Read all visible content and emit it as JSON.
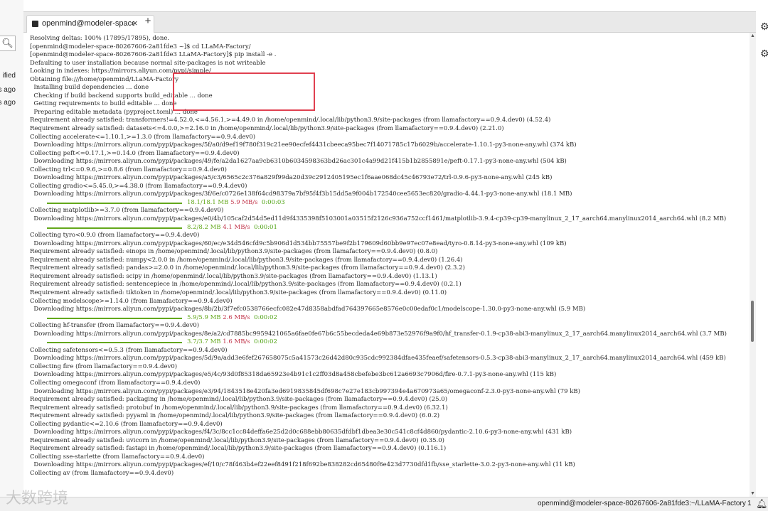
{
  "left_panel": {
    "search_icon": "search-icon",
    "labels": [
      "ified",
      "s ago",
      "s ago"
    ]
  },
  "right_panel": {
    "icons": [
      "gear-icon",
      "settings-icon"
    ]
  },
  "terminal": {
    "tab_title": "openmind@modeler-space-8",
    "tab_close": "×",
    "new_tab": "+",
    "lines": [
      {
        "text": "Resolving deltas: 100% (17895/17895), done."
      },
      {
        "text": "[openmind@modeler-space-80267606-2a81fde3 ~]$ cd LLaMA-Factory/"
      },
      {
        "text": "[openmind@modeler-space-80267606-2a81fde3 LLaMA-Factory]$ pip install -e ."
      },
      {
        "text": "Defaulting to user installation because normal site-packages is not writeable"
      },
      {
        "text": "Looking in indexes: https://mirrors.aliyun.com/pypi/simple/"
      },
      {
        "text": "Obtaining file:///home/openmind/LLaMA-Factory"
      },
      {
        "text": "  Installing build dependencies ... done"
      },
      {
        "text": "  Checking if build backend supports build_editable ... done"
      },
      {
        "text": "  Getting requirements to build editable ... done"
      },
      {
        "text": "  Preparing editable metadata (pyproject.toml) ... done"
      },
      {
        "text": "Requirement already satisfied: transformers!=4.52.0,<=4.56.1,>=4.49.0 in /home/openmind/.local/lib/python3.9/site-packages (from llamafactory==0.9.4.dev0) (4.52.4)"
      },
      {
        "text": "Requirement already satisfied: datasets<=4.0.0,>=2.16.0 in /home/openmind/.local/lib/python3.9/site-packages (from llamafactory==0.9.4.dev0) (2.21.0)"
      },
      {
        "text": "Collecting accelerate<=1.10.1,>=1.3.0 (from llamafactory==0.9.4.dev0)"
      },
      {
        "text": "  Downloading https://mirrors.aliyun.com/pypi/packages/5f/a0/d9ef19f780f319c21ee90ecfef4431cbeeca95bec7f14071785c17b6029b/accelerate-1.10.1-py3-none-any.whl (374 kB)"
      },
      {
        "text": "Collecting peft<=0.17.1,>=0.14.0 (from llamafactory==0.9.4.dev0)"
      },
      {
        "text": "  Downloading https://mirrors.aliyun.com/pypi/packages/49/fe/a2da1627aa9cb6310b6034598363bd26ac301c4a99d21f415b1b2855891e/peft-0.17.1-py3-none-any.whl (504 kB)"
      },
      {
        "text": "Collecting trl<=0.9.6,>=0.8.6 (from llamafactory==0.9.4.dev0)"
      },
      {
        "text": "  Downloading https://mirrors.aliyun.com/pypi/packages/a5/c3/6565c2c376a829f99da20d39c2912405195ec1f6aae068dc45c46793e72/trl-0.9.6-py3-none-any.whl (245 kB)"
      },
      {
        "text": "Collecting gradio<=5.45.0,>=4.38.0 (from llamafactory==0.9.4.dev0)"
      },
      {
        "text": "  Downloading https://mirrors.aliyun.com/pypi/packages/3f/6e/c0726e138f64cd98379a7bf95f4f3b15dd5a9f004b172540cee5653ec820/gradio-4.44.1-py3-none-any.whl (18.1 MB)"
      },
      {
        "progress": true,
        "size": "18.1/18.1 MB",
        "speed": "5.9 MB/s",
        "time": "0:00:03"
      },
      {
        "text": "Collecting matplotlib>=3.7.0 (from llamafactory==0.9.4.dev0)"
      },
      {
        "text": "  Downloading https://mirrors.aliyun.com/pypi/packages/e0/4b/105caf2d54d5ed11d9f4335398f5103001a03515f2126c936a752ccf1461/matplotlib-3.9.4-cp39-cp39-manylinux_2_17_aarch64.manylinux2014_aarch64.whl (8.2 MB)"
      },
      {
        "progress": true,
        "size": "8.2/8.2 MB",
        "speed": "4.1 MB/s",
        "time": "0:00:01"
      },
      {
        "text": "Collecting tyro<0.9.0 (from llamafactory==0.9.4.dev0)"
      },
      {
        "text": "  Downloading https://mirrors.aliyun.com/pypi/packages/60/ec/e34d546cfd9c5b906d1d534bb75557be9f2b179609d60bb9e97ec07e8ead/tyro-0.8.14-py3-none-any.whl (109 kB)"
      },
      {
        "text": "Requirement already satisfied: einops in /home/openmind/.local/lib/python3.9/site-packages (from llamafactory==0.9.4.dev0) (0.8.0)"
      },
      {
        "text": "Requirement already satisfied: numpy<2.0.0 in /home/openmind/.local/lib/python3.9/site-packages (from llamafactory==0.9.4.dev0) (1.26.4)"
      },
      {
        "text": "Requirement already satisfied: pandas>=2.0.0 in /home/openmind/.local/lib/python3.9/site-packages (from llamafactory==0.9.4.dev0) (2.3.2)"
      },
      {
        "text": "Requirement already satisfied: scipy in /home/openmind/.local/lib/python3.9/site-packages (from llamafactory==0.9.4.dev0) (1.13.1)"
      },
      {
        "text": "Requirement already satisfied: sentencepiece in /home/openmind/.local/lib/python3.9/site-packages (from llamafactory==0.9.4.dev0) (0.2.1)"
      },
      {
        "text": "Requirement already satisfied: tiktoken in /home/openmind/.local/lib/python3.9/site-packages (from llamafactory==0.9.4.dev0) (0.11.0)"
      },
      {
        "text": "Collecting modelscope>=1.14.0 (from llamafactory==0.9.4.dev0)"
      },
      {
        "text": "  Downloading https://mirrors.aliyun.com/pypi/packages/8b/2b/3f7efc0538766ecfc082e47d8358abdfad764397665e8576e0c00edaf0c1/modelscope-1.30.0-py3-none-any.whl (5.9 MB)"
      },
      {
        "progress": true,
        "size": "5.9/5.9 MB",
        "speed": "2.6 MB/s",
        "time": "0:00:02"
      },
      {
        "text": "Collecting hf-transfer (from llamafactory==0.9.4.dev0)"
      },
      {
        "text": "  Downloading https://mirrors.aliyun.com/pypi/packages/8e/a2/cd7885bc9959421065a6fae0fe67b6c55becdeda4e69b873e52976f9a9f0/hf_transfer-0.1.9-cp38-abi3-manylinux_2_17_aarch64.manylinux2014_aarch64.whl (3.7 MB)"
      },
      {
        "progress": true,
        "size": "3.7/3.7 MB",
        "speed": "1.6 MB/s",
        "time": "0:00:02"
      },
      {
        "text": "Collecting safetensors<=0.5.3 (from llamafactory==0.9.4.dev0)"
      },
      {
        "text": "  Downloading https://mirrors.aliyun.com/pypi/packages/5d/9a/add3e6fef267658075c5a41573c26d42d80c935cdc992384dfae435feaef/safetensors-0.5.3-cp38-abi3-manylinux_2_17_aarch64.manylinux2014_aarch64.whl (459 kB)"
      },
      {
        "text": "Collecting fire (from llamafactory==0.9.4.dev0)"
      },
      {
        "text": "  Downloading https://mirrors.aliyun.com/pypi/packages/e5/4c/93d0f85318da65923e4b91c1c2ff03d8a458cbefebe3bc612a6693c7906d/fire-0.7.1-py3-none-any.whl (115 kB)"
      },
      {
        "text": "Collecting omegaconf (from llamafactory==0.9.4.dev0)"
      },
      {
        "text": "  Downloading https://mirrors.aliyun.com/pypi/packages/e3/94/1843518e420fa3ed6919835845df698c7e27e183cb997394e4a670973a65/omegaconf-2.3.0-py3-none-any.whl (79 kB)"
      },
      {
        "text": "Requirement already satisfied: packaging in /home/openmind/.local/lib/python3.9/site-packages (from llamafactory==0.9.4.dev0) (25.0)"
      },
      {
        "text": "Requirement already satisfied: protobuf in /home/openmind/.local/lib/python3.9/site-packages (from llamafactory==0.9.4.dev0) (6.32.1)"
      },
      {
        "text": "Requirement already satisfied: pyyaml in /home/openmind/.local/lib/python3.9/site-packages (from llamafactory==0.9.4.dev0) (6.0.2)"
      },
      {
        "text": "Collecting pydantic<=2.10.6 (from llamafactory==0.9.4.dev0)"
      },
      {
        "text": "  Downloading https://mirrors.aliyun.com/pypi/packages/f4/3c/8cc1cc84deffa6e25d2d0c688ebb80635dfdbf1dbea3e30c541c8cf4d860/pydantic-2.10.6-py3-none-any.whl (431 kB)"
      },
      {
        "text": "Requirement already satisfied: uvicorn in /home/openmind/.local/lib/python3.9/site-packages (from llamafactory==0.9.4.dev0) (0.35.0)"
      },
      {
        "text": "Requirement already satisfied: fastapi in /home/openmind/.local/lib/python3.9/site-packages (from llamafactory==0.9.4.dev0) (0.116.1)"
      },
      {
        "text": "Collecting sse-starlette (from llamafactory==0.9.4.dev0)"
      },
      {
        "text": "  Downloading https://mirrors.aliyun.com/pypi/packages/ef/10/c78f463b4ef22eef8491f218f692be838282cd65480f6e423d7730dfd1fb/sse_starlette-3.0.2-py3-none-any.whl (11 kB)"
      },
      {
        "text": "Collecting av (from llamafactory==0.9.4.dev0)"
      }
    ]
  },
  "statusbar": {
    "path": "openmind@modeler-space-80267606-2a81fde3:~/LLaMA-Factory",
    "count": "1",
    "bell_icon": "bell-icon"
  },
  "watermark": "大数跨境"
}
